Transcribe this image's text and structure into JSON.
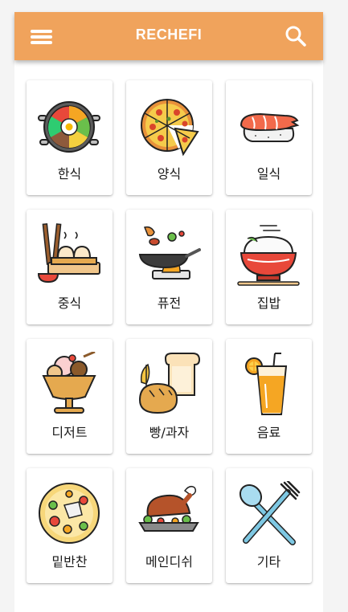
{
  "header": {
    "title": "RECHEFI",
    "menu_icon": "menu-icon",
    "search_icon": "search-icon",
    "bg_color": "#f0a35c"
  },
  "categories": [
    {
      "label": "한식",
      "icon": "bibimbap-icon"
    },
    {
      "label": "양식",
      "icon": "pizza-icon"
    },
    {
      "label": "일식",
      "icon": "sushi-icon"
    },
    {
      "label": "중식",
      "icon": "dumplings-icon"
    },
    {
      "label": "퓨전",
      "icon": "wok-icon"
    },
    {
      "label": "집밥",
      "icon": "rice-bowl-icon"
    },
    {
      "label": "디저트",
      "icon": "ice-cream-icon"
    },
    {
      "label": "빵/과자",
      "icon": "bread-icon"
    },
    {
      "label": "음료",
      "icon": "drink-icon"
    },
    {
      "label": "밑반찬",
      "icon": "side-dish-icon"
    },
    {
      "label": "메인디쉬",
      "icon": "roast-chicken-icon"
    },
    {
      "label": "기타",
      "icon": "utensils-icon"
    }
  ]
}
